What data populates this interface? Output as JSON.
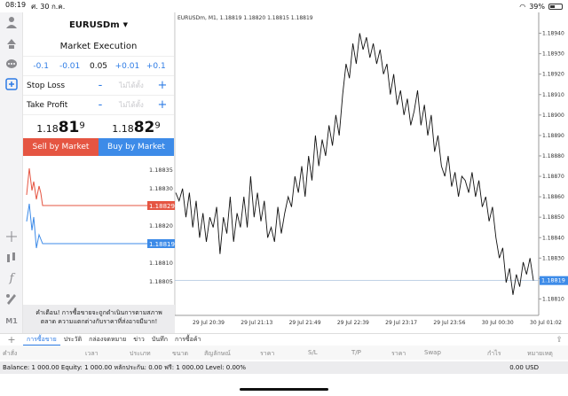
{
  "status": {
    "time": "08:19",
    "date": "ศ. 30 ก.ค.",
    "battery": "39%"
  },
  "icons": [
    "person-icon",
    "trade-icon",
    "chat-icon",
    "new-order-icon",
    "crosshair-icon",
    "indicator-icon",
    "function-icon",
    "objects-icon",
    "timeframe-icon"
  ],
  "toolbar": {
    "timeframe": "M1"
  },
  "order": {
    "symbol": "EURUSDm",
    "execution": "Market Execution",
    "volume": [
      "-0.1",
      "-0.01",
      "0.05",
      "+0.01",
      "+0.1"
    ],
    "stop_loss": {
      "label": "Stop Loss",
      "placeholder": "ไม่ได้ตั้ง",
      "minus": "-",
      "plus": "+"
    },
    "take_profit": {
      "label": "Take Profit",
      "placeholder": "ไม่ได้ตั้ง",
      "minus": "-",
      "plus": "+"
    },
    "bid": {
      "prefix": "1.18",
      "big": "81",
      "sup": "9"
    },
    "ask": {
      "prefix": "1.18",
      "big": "82",
      "sup": "9"
    },
    "sell_label": "Sell by Market",
    "buy_label": "Buy by Market",
    "warning": "คำเตือน! การซื้อขายจะถูกดำเนินการตามสภาพตลาด ความแตกต่างกับราคาที่ส่งอาจมีมาก!"
  },
  "mini_chart": {
    "ticks": [
      "1.18835",
      "1.18830",
      "1.18825",
      "1.18820",
      "1.18815",
      "1.18810",
      "1.18805"
    ],
    "ask_label": "1.18829",
    "bid_label": "1.18819",
    "ask_color": "#e55542",
    "bid_color": "#3d8be8"
  },
  "chart_data": {
    "type": "line",
    "title": "EURUSDm, M1, 1.18819 1.18820 1.18815 1.18819",
    "x_labels": [
      "29 Jul 20:39",
      "29 Jul 21:13",
      "29 Jul 21:49",
      "29 Jul 22:39",
      "29 Jul 23:17",
      "29 Jul 23:56",
      "30 Jul 00:30",
      "30 Jul 01:02"
    ],
    "y_ticks": [
      "1.18940",
      "1.18930",
      "1.18920",
      "1.18910",
      "1.18900",
      "1.18890",
      "1.18880",
      "1.18870",
      "1.18860",
      "1.18850",
      "1.18840",
      "1.18830",
      "1.18820",
      "1.18810"
    ],
    "ylim": [
      1.18805,
      1.18945
    ],
    "current_price": "1.18819",
    "current_value": 1.18819,
    "series": [
      {
        "values": [
          1.18862,
          1.18858,
          1.18864,
          1.1885,
          1.18862,
          1.18845,
          1.18858,
          1.1884,
          1.18852,
          1.18838,
          1.1885,
          1.18845,
          1.18855,
          1.18832,
          1.1885,
          1.18842,
          1.1886,
          1.18838,
          1.18852,
          1.18845,
          1.1886,
          1.18845,
          1.1887,
          1.1885,
          1.18862,
          1.18848,
          1.18858,
          1.1884,
          1.18845,
          1.18838,
          1.18855,
          1.18842,
          1.18852,
          1.1886,
          1.18855,
          1.1887,
          1.18862,
          1.18875,
          1.1886,
          1.1888,
          1.18868,
          1.1889,
          1.18875,
          1.18888,
          1.1888,
          1.18895,
          1.18885,
          1.189,
          1.1889,
          1.1891,
          1.18925,
          1.18918,
          1.18935,
          1.18925,
          1.1894,
          1.18932,
          1.18938,
          1.18928,
          1.18935,
          1.18925,
          1.18932,
          1.1892,
          1.18925,
          1.1891,
          1.1892,
          1.18905,
          1.18912,
          1.189,
          1.18908,
          1.18895,
          1.18902,
          1.18912,
          1.18895,
          1.18905,
          1.1889,
          1.189,
          1.18882,
          1.1889,
          1.18875,
          1.1887,
          1.1888,
          1.18865,
          1.18872,
          1.1886,
          1.1887,
          1.18868,
          1.18862,
          1.18872,
          1.1886,
          1.18868,
          1.18855,
          1.1886,
          1.18848,
          1.18855,
          1.1884,
          1.1883,
          1.18835,
          1.18818,
          1.18825,
          1.18812,
          1.18822,
          1.18816,
          1.18828,
          1.18822,
          1.1883,
          1.18819
        ]
      }
    ]
  },
  "tabs": {
    "add": "+",
    "items": [
      "การซื้อขาย",
      "ประวัติ",
      "กล่องจดหมาย",
      "ข่าว",
      "บันทึก",
      "การซื้อค้า"
    ],
    "export": "⇪"
  },
  "columns": [
    "คำสั่ง",
    "เวลา",
    "ประเภท",
    "ขนาด",
    "สัญลักษณ์",
    "ราคา",
    "S/L",
    "T/P",
    "ราคา",
    "Swap",
    "กำไร",
    "หมายเหตุ"
  ],
  "balance": {
    "text": "Balance: 1 000.00 Equity: 1 000.00 หลักประกัน: 0.00 ฟรี: 1 000.00 Level: 0.00%",
    "amount": "0.00  USD"
  }
}
